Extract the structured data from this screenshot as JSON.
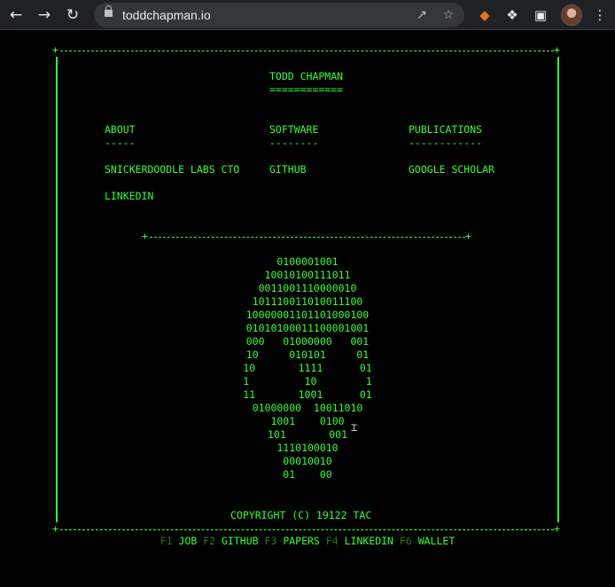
{
  "browser": {
    "url": "toddchapman.io"
  },
  "header": {
    "title": "TODD CHAPMAN",
    "underline": "============"
  },
  "sections": [
    {
      "label": "ABOUT",
      "underline": "-----",
      "links": [
        "SNICKERDOODLE LABS CTO",
        "LINKEDIN"
      ]
    },
    {
      "label": "SOFTWARE",
      "underline": "--------",
      "links": [
        "GITHUB"
      ]
    },
    {
      "label": "PUBLICATIONS",
      "underline": "------------",
      "links": [
        "GOOGLE SCHOLAR"
      ]
    }
  ],
  "ascii_art": [
    "0100001001",
    "10010100111011",
    "0011001110000010",
    "101110011010011100",
    "10000001101101000100",
    "01010100011100001001",
    "000   01000000   001",
    "10     010101     01",
    "10       1111      01",
    "1         10        1",
    "11       1001      01",
    "01000000  10011010",
    "1001    0100",
    "101       001",
    "1110100010",
    "00010010",
    "01    00"
  ],
  "copyright": "COPYRIGHT (C) 19122 TAC",
  "function_keys": [
    {
      "key": "F1",
      "label": "JOB"
    },
    {
      "key": "F2",
      "label": "GITHUB"
    },
    {
      "key": "F3",
      "label": "PAPERS"
    },
    {
      "key": "F4",
      "label": "LINKEDIN"
    },
    {
      "key": "F6",
      "label": "WALLET"
    }
  ],
  "colors": {
    "terminal_green": "#33ff33",
    "dim_green": "#1f7a1f",
    "background": "#000000"
  }
}
